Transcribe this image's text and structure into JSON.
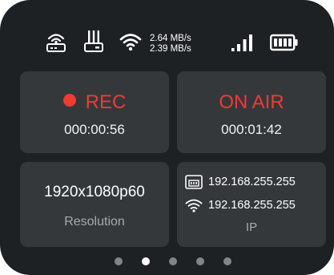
{
  "status": {
    "icons": [
      "router-icon",
      "ethernet-icon",
      "wifi-icon",
      "signal-icon",
      "battery-icon"
    ],
    "speed_up": "2.64 MB/s",
    "speed_down": "2.39 MB/s"
  },
  "rec": {
    "label": "REC",
    "time": "000:00:56"
  },
  "on_air": {
    "label": "ON AIR",
    "time": "000:01:42"
  },
  "resolution": {
    "value": "1920x1080p60",
    "label": "Resolution"
  },
  "ip": {
    "ethernet": "192.168.255.255",
    "wifi": "192.168.255.255",
    "label": "IP"
  },
  "pager": {
    "count": 5,
    "active": 1
  },
  "colors": {
    "background": "#1e2124",
    "tile": "#34383b",
    "accent_red": "#ef3b35",
    "muted_text": "#a7abae"
  }
}
